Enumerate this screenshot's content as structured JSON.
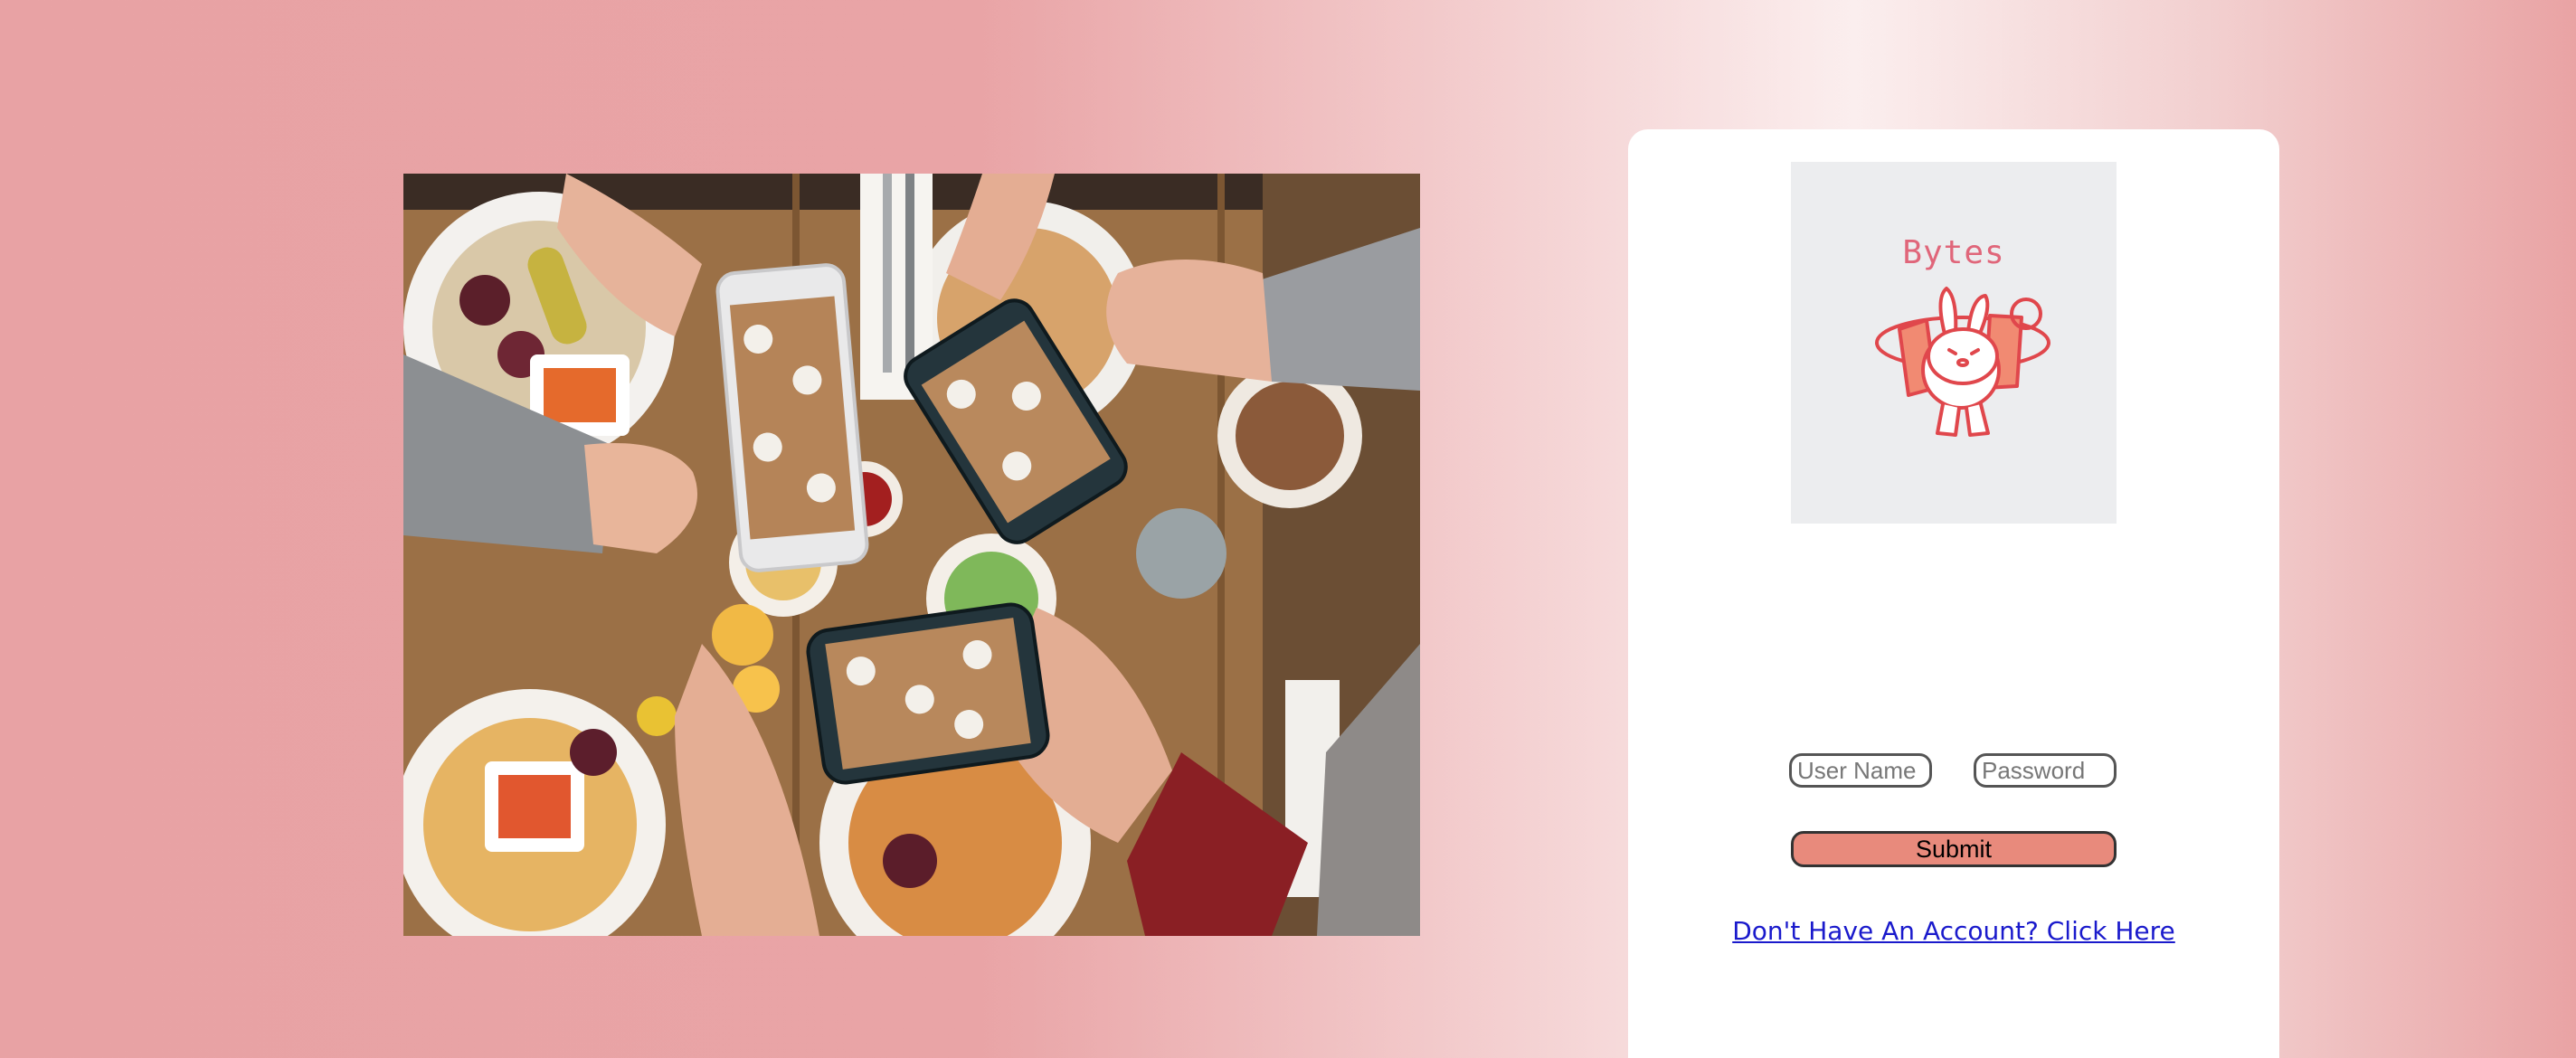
{
  "hero": {
    "icon": "food-table-photo"
  },
  "login": {
    "logo_text": "Bytes",
    "logo_icon": "bunny-mascot-icon",
    "username_placeholder": "User Name",
    "password_placeholder": "Password",
    "submit_label": "Submit",
    "signup_link": "Don't Have An Account? Click Here"
  },
  "colors": {
    "page_pink": "#e8a2a4",
    "submit_fill": "#e88a7c",
    "logo_pink": "#e0667a",
    "link_blue": "#1a1acc"
  }
}
